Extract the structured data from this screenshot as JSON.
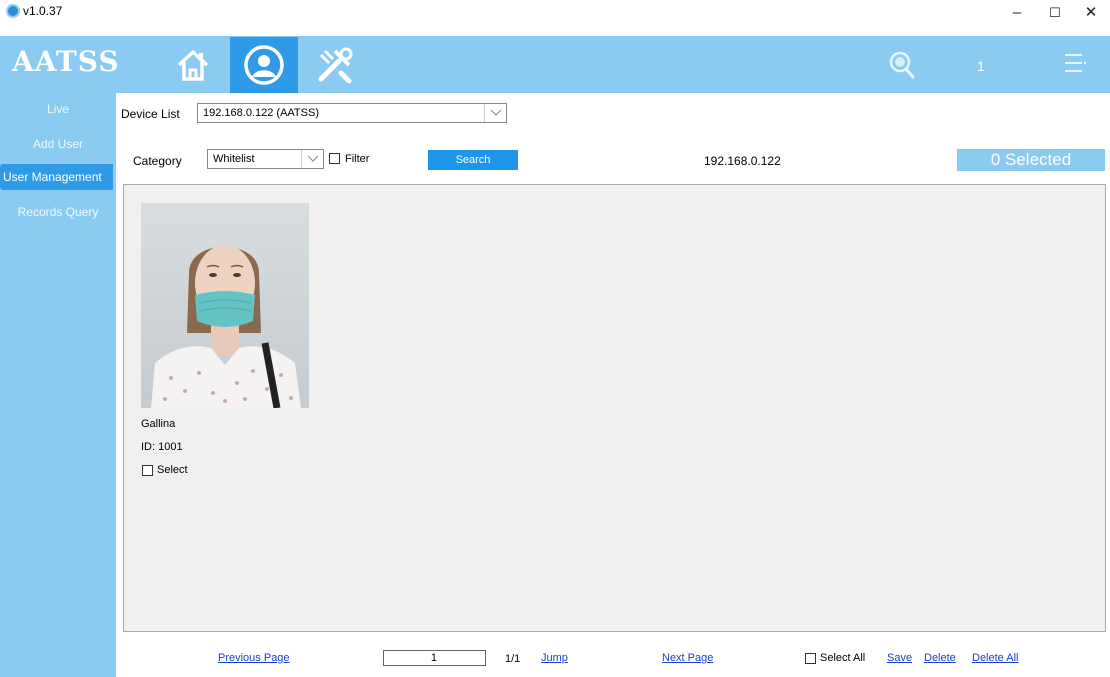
{
  "window": {
    "version": "v1.0.37",
    "minimize": "–",
    "maximize": "☐",
    "close": "✕"
  },
  "header": {
    "logo": "AATSS",
    "nav": [
      {
        "icon": "home-icon"
      },
      {
        "icon": "user-icon",
        "active": true
      },
      {
        "icon": "tools-icon"
      }
    ],
    "notification_count": "1",
    "colors": {
      "bar": "#8ccbf1",
      "active": "#2f9be7"
    }
  },
  "sidebar": {
    "items": [
      {
        "label": "Live"
      },
      {
        "label": "Add User"
      },
      {
        "label": "User Management",
        "active": true
      },
      {
        "label": "Records Query"
      }
    ]
  },
  "toolbar": {
    "device_list_label": "Device List",
    "device_value": "192.168.0.122 (AATSS)",
    "category_label": "Category",
    "category_value": "Whitelist",
    "filter_label": "Filter",
    "search_label": "Search",
    "current_ip": "192.168.0.122",
    "selected_count": "0 Selected"
  },
  "users": [
    {
      "name": "Gallina",
      "id_text": "ID: 1001",
      "select_label": "Select"
    }
  ],
  "footer": {
    "prev": "Previous Page",
    "page_value": "1",
    "page_total": "1/1",
    "jump": "Jump",
    "next": "Next Page",
    "select_all": "Select All",
    "save": "Save",
    "delete": "Delete",
    "delete_all": "Delete All"
  }
}
